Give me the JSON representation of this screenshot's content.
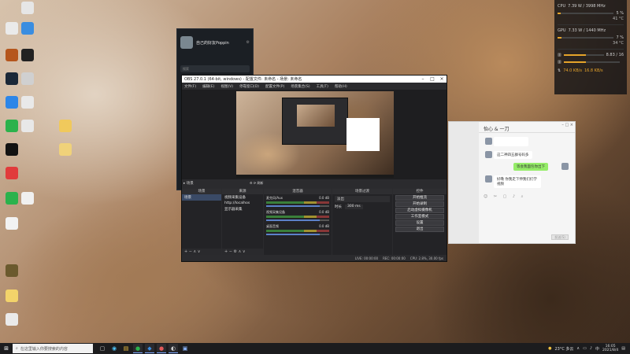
{
  "desktop": {
    "icons": [
      {
        "label": "",
        "color": "#e6e6e6"
      },
      {
        "label": "",
        "color": "#eaeaea"
      },
      {
        "label": "",
        "color": "#3a8de0"
      },
      {
        "label": "",
        "color": "#b5561d"
      },
      {
        "label": "",
        "color": "#222222"
      },
      {
        "label": "",
        "color": "#1b2838"
      },
      {
        "label": "",
        "color": "#d0d0d0"
      },
      {
        "label": "",
        "color": "#2d86e8"
      },
      {
        "label": "",
        "color": "#e9e9e9"
      },
      {
        "label": "",
        "color": "#2bb24c"
      },
      {
        "label": "",
        "color": "#e8e8e8"
      },
      {
        "label": "",
        "color": "#f0c95c"
      },
      {
        "label": "",
        "color": "#121212"
      },
      {
        "label": "",
        "color": "#f0d27a"
      },
      {
        "label": "",
        "color": "#e13b3b"
      },
      {
        "label": "",
        "color": "#2bb24c"
      },
      {
        "label": "",
        "color": "#f0f0f0"
      },
      {
        "label": "",
        "color": "#f2f2f2"
      },
      {
        "label": "",
        "color": "#6b5a2e"
      },
      {
        "label": "",
        "color": "#f3d36a"
      },
      {
        "label": "",
        "color": "#eaeaea"
      }
    ]
  },
  "hwmon": {
    "cpu": {
      "label": "CPU",
      "freq": "7.39 W / 3998 MHz",
      "percent": "5 %",
      "temp": "41 °C"
    },
    "gpu": {
      "label": "GPU",
      "freq": "7.33 W / 1440 MHz",
      "percent": "7 %",
      "temp": "34 °C"
    },
    "ram": {
      "label": "",
      "value": "8.83 / 16"
    },
    "net": {
      "up": "74.0 KB/s",
      "down": "16.8 KB/s"
    }
  },
  "qq_dark": {
    "name": "自己的好友Poppin",
    "sub": "",
    "search_placeholder": "搜索"
  },
  "obs": {
    "title": "OBS 27.0.1 (64-bit, windows) - 配置文件: 未命名 - 场景: 未命名",
    "menu": [
      "文件(F)",
      "编辑(E)",
      "视图(V)",
      "停靠窗口(D)",
      "配置文件(P)",
      "场景集合(S)",
      "工具(T)",
      "帮助(H)"
    ],
    "scene_label": "▸ 场景",
    "scene_tools": "⚙ ⟳ 刷新",
    "docks": {
      "scenes": {
        "title": "场景",
        "items": [
          "场景"
        ],
        "footer": "+ − ∧ ∨"
      },
      "sources": {
        "title": "来源",
        "items": [
          "视频采集设备",
          "http://localhos",
          "显示器采集"
        ],
        "footer": "+ − ⚙ ∧ ∨"
      },
      "mixer": {
        "title": "混音器",
        "channels": [
          {
            "name": "麦克风/Aux",
            "db": "0.0 dB"
          },
          {
            "name": "视频采集设备",
            "db": "0.0 dB"
          },
          {
            "name": "桌面音频",
            "db": "0.0 dB"
          }
        ]
      },
      "transitions": {
        "title": "场景过渡",
        "type": "淡出",
        "duration_label": "时长",
        "duration": "300 ms"
      },
      "controls": {
        "title": "控件",
        "buttons": [
          "开始推流",
          "开始录制",
          "启动虚拟摄像机",
          "工作室模式",
          "设置",
          "退出"
        ]
      }
    },
    "status": {
      "live": "LIVE: 00:00:00",
      "rec": "REC: 00:00:00",
      "cpu": "CPU: 2.8%, 30.00 fps"
    }
  },
  "qq_chat": {
    "title": "怡心 & 一刀",
    "left_items": [
      "",
      "",
      "",
      "",
      ""
    ],
    "messages": [
      {
        "dir": "in",
        "text": "这二神四五群号码多"
      },
      {
        "dir": "out",
        "text": "等会我面包你出下"
      },
      {
        "dir": "in",
        "text": "好嘞 你我走下伸我们们学视频"
      }
    ],
    "tools": "☺ ✂ ▢ ♪ ⌕",
    "send": "发送(S)"
  },
  "taskbar": {
    "search_placeholder": "在这里输入你要搜索的内容",
    "apps": [
      {
        "icon": "▢",
        "color": "#cfcfcf",
        "name": "task-view-icon"
      },
      {
        "icon": "◉",
        "color": "#4fc3f7",
        "name": "edge-icon"
      },
      {
        "icon": "▤",
        "color": "#f0c040",
        "name": "explorer-icon"
      },
      {
        "icon": "●",
        "color": "#2bb24c",
        "name": "wechat-icon"
      },
      {
        "icon": "◆",
        "color": "#3a8de0",
        "name": "qq-icon"
      },
      {
        "icon": "●",
        "color": "#e05a5a",
        "name": "music-icon"
      },
      {
        "icon": "◐",
        "color": "#cfcfcf",
        "name": "obs-icon"
      },
      {
        "icon": "▣",
        "color": "#8ab4f8",
        "name": "app-icon"
      }
    ],
    "weather": "23°C 多云",
    "lang": "中",
    "time": "16:05",
    "date": "2021/8/4"
  }
}
